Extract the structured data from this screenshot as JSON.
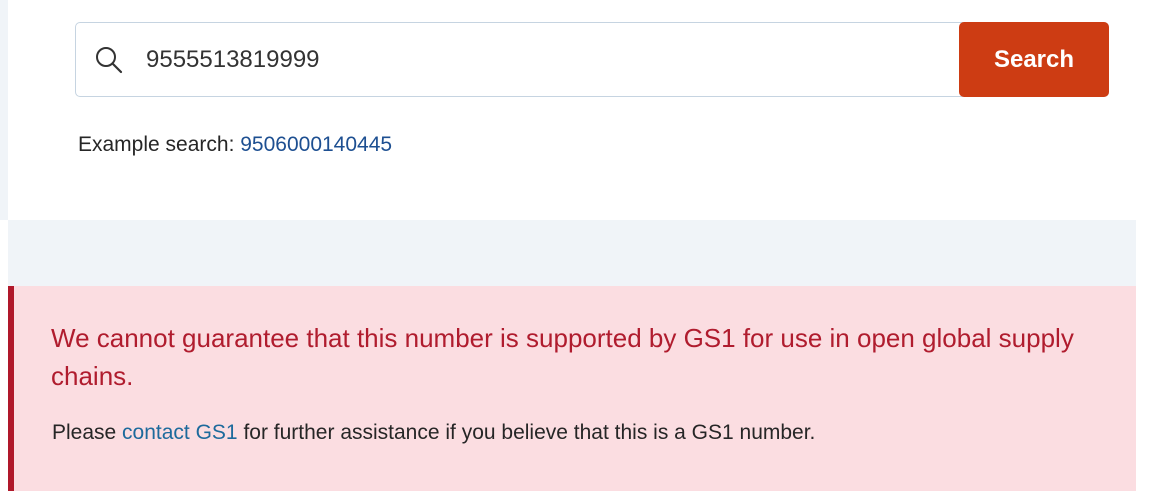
{
  "search": {
    "value": "9555513819999",
    "button_label": "Search",
    "icon": "search-icon"
  },
  "example": {
    "prefix": "Example search: ",
    "number": "9506000140445"
  },
  "alert": {
    "title": "We cannot guarantee that this number is supported by GS1 for use in open global supply chains.",
    "body_prefix": "Please ",
    "link_text": "contact GS1",
    "body_suffix": " for further assistance if you believe that this is a GS1 number."
  },
  "colors": {
    "button": "#cd3c13",
    "link": "#1d4f91",
    "alert_bg": "#fbdde1",
    "alert_title": "#b01c2e",
    "alert_border": "#b0182a",
    "band": "#f0f4f8"
  }
}
